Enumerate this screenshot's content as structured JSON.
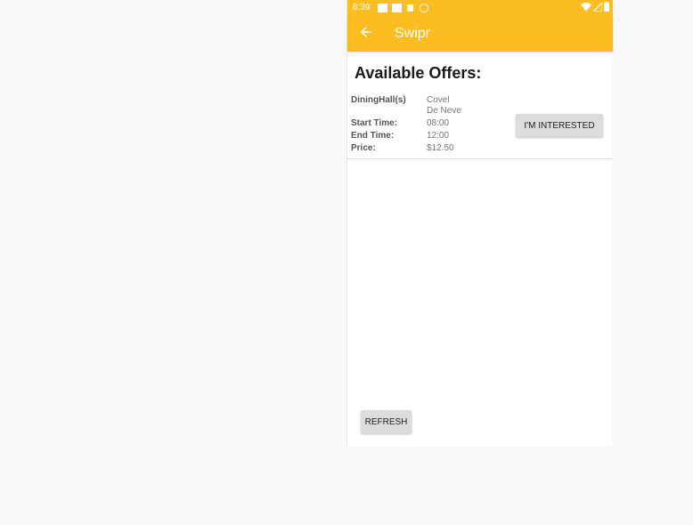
{
  "status_bar": {
    "time": "6:39"
  },
  "app_bar": {
    "back_icon": "arrow-left-icon",
    "title": "Swipr"
  },
  "heading": "Available Offers:",
  "offer": {
    "dining_halls_label": "DiningHall(s)",
    "dining_halls": [
      "Covel",
      "De Neve"
    ],
    "start_time_label": "Start Time:",
    "start_time": "08:00",
    "end_time_label": "End Time:",
    "end_time": "12:00",
    "price_label": "Price:",
    "price": "$12.50",
    "interested_label": "I'M INTERESTED"
  },
  "refresh_label": "REFRESH",
  "colors": {
    "accent": "#fbbd20",
    "background": "#f8f8f8",
    "button": "#dcdcdc"
  }
}
